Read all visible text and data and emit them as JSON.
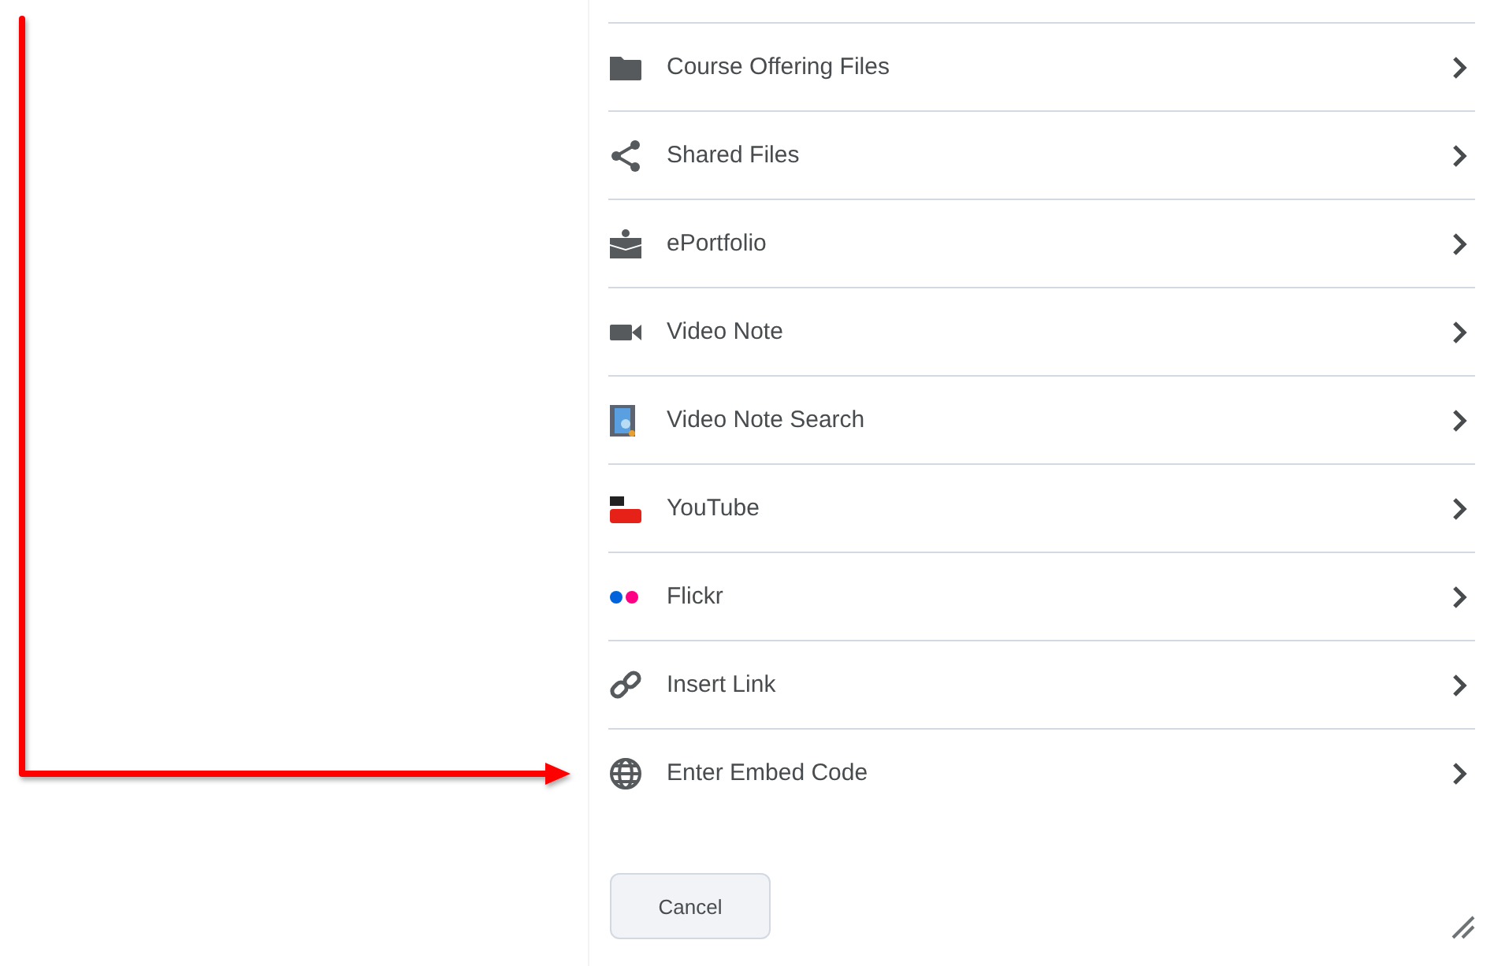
{
  "items": [
    {
      "label": "Course Offering Files"
    },
    {
      "label": "Shared Files"
    },
    {
      "label": "ePortfolio"
    },
    {
      "label": "Video Note"
    },
    {
      "label": "Video Note Search"
    },
    {
      "label": "YouTube"
    },
    {
      "label": "Flickr"
    },
    {
      "label": "Insert Link"
    },
    {
      "label": "Enter Embed Code"
    }
  ],
  "buttons": [
    {
      "label": "Cancel"
    }
  ]
}
